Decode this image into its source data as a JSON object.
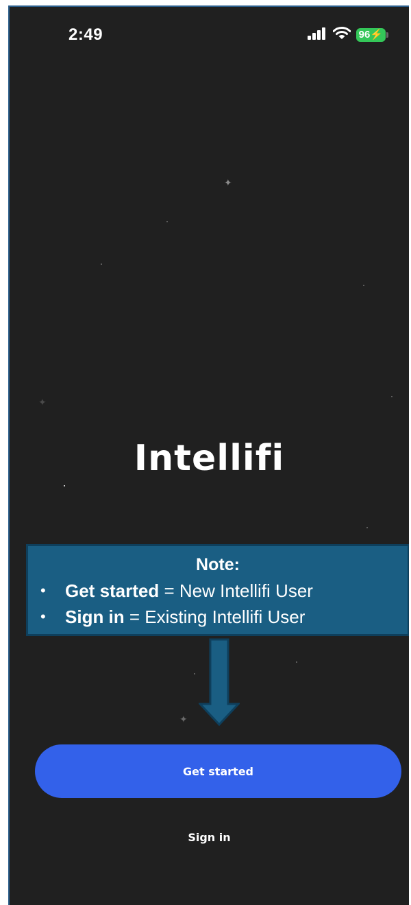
{
  "status_bar": {
    "time": "2:49",
    "battery": "96",
    "icons": [
      "signal-icon",
      "wifi-icon",
      "battery-icon"
    ]
  },
  "app": {
    "title": "Intellifi"
  },
  "note": {
    "heading": "Note:",
    "items": [
      {
        "term": "Get started",
        "description": " = New Intellifi User"
      },
      {
        "term": "Sign in",
        "description": " = Existing Intellifi User"
      }
    ],
    "background_color": "#1a5e83"
  },
  "actions": {
    "get_started_label": "Get started",
    "sign_in_label": "Sign in"
  },
  "colors": {
    "background": "#202020",
    "primary_button": "#3361ea",
    "battery": "#34c759"
  }
}
